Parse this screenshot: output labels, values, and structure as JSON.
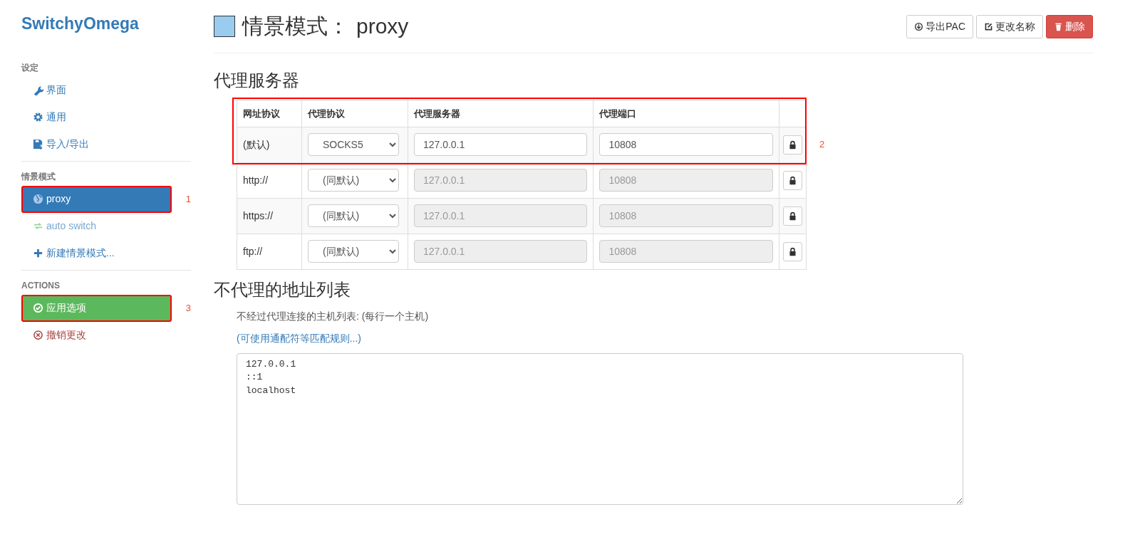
{
  "sidebar": {
    "brand": "SwitchyOmega",
    "sections": [
      {
        "heading": "设定",
        "items": [
          {
            "label": "界面",
            "kind": "link",
            "selected": false
          },
          {
            "label": "通用",
            "kind": "link",
            "selected": false
          },
          {
            "label": "导入/导出",
            "kind": "link",
            "selected": false
          }
        ]
      },
      {
        "heading": "情景模式",
        "items": [
          {
            "label": "proxy",
            "kind": "link",
            "selected": true,
            "callout": "1"
          },
          {
            "label": "auto switch",
            "kind": "muted-green",
            "selected": false
          },
          {
            "label": "新建情景模式...",
            "kind": "link",
            "selected": false
          }
        ]
      },
      {
        "heading": "ACTIONS",
        "items": [
          {
            "label": "应用选项",
            "kind": "success",
            "selected": false,
            "callout": "3"
          },
          {
            "label": "撤销更改",
            "kind": "danger-text",
            "selected": false
          }
        ]
      }
    ]
  },
  "header": {
    "color": "#99ccee",
    "title_label": "情景模式：",
    "title_name": "proxy",
    "buttons": [
      {
        "label": "导出PAC",
        "kind": "default"
      },
      {
        "label": "更改名称",
        "kind": "default"
      },
      {
        "label": "删除",
        "kind": "danger"
      }
    ]
  },
  "proxy_servers": {
    "heading": "代理服务器",
    "callout": "2",
    "columns": [
      "网址协议",
      "代理协议",
      "代理服务器",
      "代理端口"
    ],
    "rows": [
      {
        "scheme": "(默认)",
        "protocol": "SOCKS5",
        "server": "127.0.0.1",
        "port": "10808",
        "disabled": false
      },
      {
        "scheme": "http://",
        "protocol": "(同默认)",
        "server": "127.0.0.1",
        "port": "10808",
        "disabled": true
      },
      {
        "scheme": "https://",
        "protocol": "(同默认)",
        "server": "127.0.0.1",
        "port": "10808",
        "disabled": true
      },
      {
        "scheme": "ftp://",
        "protocol": "(同默认)",
        "server": "127.0.0.1",
        "port": "10808",
        "disabled": true
      }
    ]
  },
  "bypass": {
    "heading": "不代理的地址列表",
    "help": "不经过代理连接的主机列表: (每行一个主机)",
    "link": "(可使用通配符等匹配规则...)",
    "value": "127.0.0.1\n::1\nlocalhost"
  }
}
